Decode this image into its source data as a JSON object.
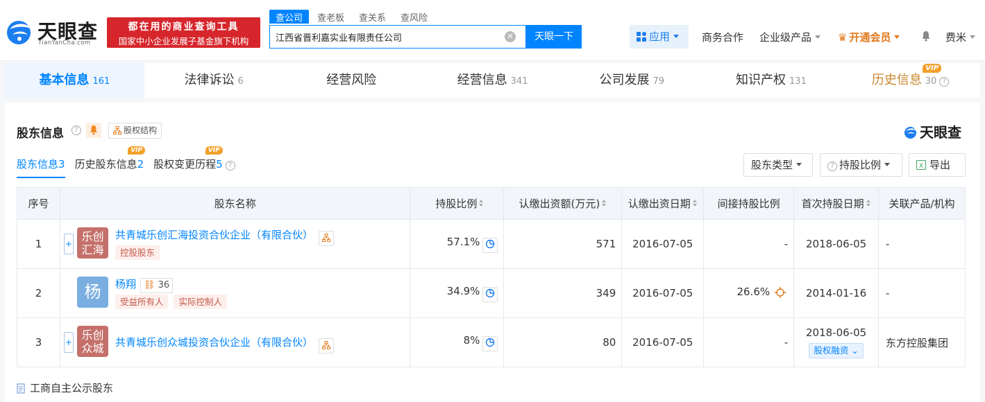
{
  "brand": {
    "name": "天眼查",
    "domain": "TianYanCha.com"
  },
  "slogan": {
    "line1": "都在用的商业查询工具",
    "line2": "国家中小企业发展子基金旗下机构"
  },
  "search": {
    "tabs": [
      "查公司",
      "查老板",
      "查关系",
      "查风险"
    ],
    "value": "江西省晋利嘉实业有限责任公司",
    "button": "天眼一下"
  },
  "nav": {
    "app": "应用",
    "business": "商务合作",
    "enterprise": "企业级产品",
    "vip": "开通会员",
    "user": "费米"
  },
  "company_tabs": [
    {
      "label": "基本信息",
      "count": "161"
    },
    {
      "label": "法律诉讼",
      "count": "6"
    },
    {
      "label": "经营风险",
      "count": ""
    },
    {
      "label": "经营信息",
      "count": "341"
    },
    {
      "label": "公司发展",
      "count": "79"
    },
    {
      "label": "知识产权",
      "count": "131"
    },
    {
      "label": "历史信息",
      "count": "30",
      "badge": "VIP"
    }
  ],
  "section": {
    "title": "股东信息",
    "struct_label": "股权结构",
    "brand": "天眼查",
    "subtabs": [
      {
        "label": "股东信息",
        "count": "3"
      },
      {
        "label": "历史股东信息",
        "count": "2",
        "badge": "VIP"
      },
      {
        "label": "股权变更历程",
        "count": "5",
        "badge": "VIP"
      }
    ],
    "filters": {
      "type": "股东类型",
      "ratio": "持股比例",
      "export": "导出"
    }
  },
  "table": {
    "headers": [
      "序号",
      "股东名称",
      "持股比例",
      "认缴出资额(万元)",
      "认缴出资日期",
      "间接持股比例",
      "首次持股日期",
      "关联产品/机构"
    ],
    "rows": [
      {
        "idx": "1",
        "avatar": "乐创汇海",
        "avatar_l1": "乐创",
        "avatar_l2": "汇海",
        "avatar_color": "#c5706a",
        "name": "共青城乐创汇海投资合伙企业（有限合伙）",
        "tags": [
          "控股股东"
        ],
        "ratio": "57.1%",
        "amount": "571",
        "date": "2016-07-05",
        "indirect": "-",
        "first_date": "2018-06-05",
        "product": "-"
      },
      {
        "idx": "2",
        "avatar": "杨",
        "avatar_color": "#7aaee0",
        "name": "杨翔",
        "related_count": "36",
        "tags": [
          "受益所有人",
          "实际控制人"
        ],
        "ratio": "34.9%",
        "amount": "349",
        "date": "2016-07-05",
        "indirect": "26.6%",
        "first_date": "2014-01-16",
        "product": "-"
      },
      {
        "idx": "3",
        "avatar": "乐创众城",
        "avatar_l1": "乐创",
        "avatar_l2": "众城",
        "avatar_color": "#c5706a",
        "name": "共青城乐创众城投资合伙企业（有限合伙）",
        "tags": [],
        "ratio": "8%",
        "amount": "80",
        "date": "2016-07-05",
        "indirect": "-",
        "first_date": "2018-06-05",
        "pledge": "股权融资",
        "product": "东方控股集团"
      }
    ]
  },
  "footer_note": "工商自主公示股东",
  "colors": {
    "accent": "#0084ff",
    "slogan_bg": "#d6262c",
    "vip": "#e0791a",
    "tag_text": "#c45a4a"
  }
}
